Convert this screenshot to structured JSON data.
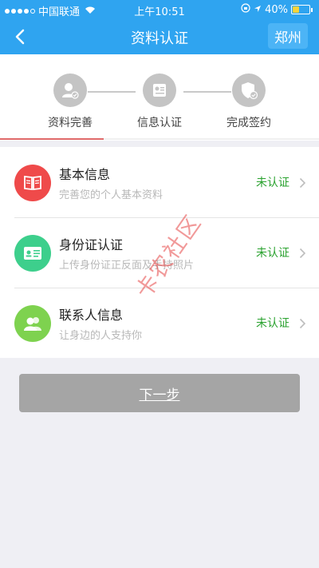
{
  "status_bar": {
    "carrier": "中国联通",
    "time": "上午10:51",
    "battery_percent": "40%",
    "battery_level": 0.4
  },
  "nav": {
    "title": "资料认证",
    "city": "郑州"
  },
  "steps": [
    {
      "label": "资料完善",
      "icon": "user-check-icon"
    },
    {
      "label": "信息认证",
      "icon": "id-card-icon"
    },
    {
      "label": "完成签约",
      "icon": "shield-check-icon"
    }
  ],
  "items": [
    {
      "title": "基本信息",
      "subtitle": "完善您的个人基本资料",
      "status": "未认证",
      "icon": "book-icon",
      "color": "#ef4a4a"
    },
    {
      "title": "身份证认证",
      "subtitle": "上传身份证正反面及手持照片",
      "status": "未认证",
      "icon": "id-card-icon",
      "color": "#3dcf8c"
    },
    {
      "title": "联系人信息",
      "subtitle": "让身边的人支持你",
      "status": "未认证",
      "icon": "contacts-icon",
      "color": "#7ed24f"
    }
  ],
  "button": {
    "next_label": "下一步"
  },
  "watermark": "卡农社区",
  "colors": {
    "primary": "#2fa4f0",
    "status_green": "#2aa22f",
    "button_gray": "#a5a5a5"
  }
}
